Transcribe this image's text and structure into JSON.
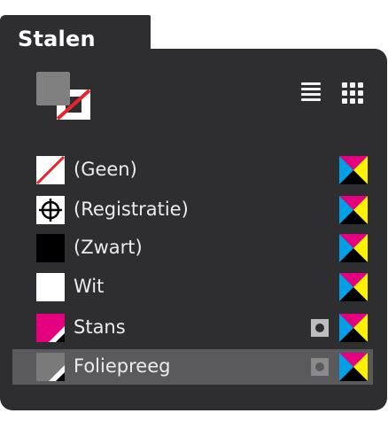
{
  "panel": {
    "title": "Stalen"
  },
  "toolbar": {
    "list_view_icon": "list-view-icon",
    "grid_view_icon": "grid-view-icon"
  },
  "swatches": [
    {
      "label": "(Geen)",
      "chip": "none",
      "spot": false
    },
    {
      "label": "(Registratie)",
      "chip": "registration",
      "spot": false
    },
    {
      "label": "(Zwart)",
      "chip": "black",
      "spot": false
    },
    {
      "label": "Wit",
      "chip": "white",
      "spot": false
    },
    {
      "label": "Stans",
      "chip": "magenta-spot",
      "spot": true
    },
    {
      "label": "Foliepreeg",
      "chip": "gray-spot",
      "spot": true,
      "selected": true
    }
  ],
  "colors": {
    "panel_bg": "#2e2e31",
    "selected_row": "#5a5a5c",
    "cyan": "#00a0e9",
    "magenta": "#e4007f",
    "yellow": "#fff100",
    "black": "#000000",
    "stans_chip": "#e4007f",
    "foliepreeg_chip": "#7a7a7a"
  }
}
